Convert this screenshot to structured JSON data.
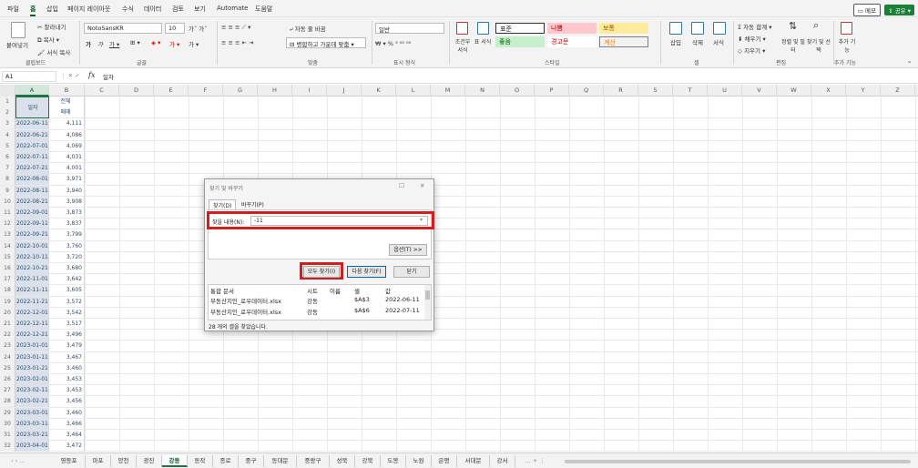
{
  "menu": {
    "file": "파일",
    "home": "홈",
    "insert": "삽입",
    "layout": "페이지 레이아웃",
    "formula": "수식",
    "data": "데이터",
    "review": "검토",
    "view": "보기",
    "automate": "Automate",
    "help": "도움말",
    "memo": "메모",
    "share": "공유"
  },
  "ribbon": {
    "clipboard": {
      "paste": "붙여넣기",
      "cut": "잘라내기",
      "copy": "복사",
      "format_painter": "서식 복사",
      "group": "클립보드"
    },
    "font": {
      "name": "NotoSansKR",
      "size": "10",
      "group": "글꼴"
    },
    "align": {
      "wrap": "자동 줄 바꿈",
      "merge": "병합하고 가운데 맞춤",
      "group": "맞춤"
    },
    "number": {
      "format": "일반",
      "group": "표시 형식"
    },
    "styles": {
      "cond": "조건부 서식",
      "table": "표 서식",
      "normal": "표준",
      "bad": "나쁨",
      "neutral": "보통",
      "good": "좋음",
      "warning": "경고문",
      "calc": "계산",
      "group": "스타일"
    },
    "cells": {
      "insert": "삽입",
      "delete": "삭제",
      "format": "서식",
      "group": "셀"
    },
    "edit": {
      "autosum": "자동 합계",
      "fill": "채우기",
      "clear": "지우기",
      "sort": "정렬 및 필터",
      "find": "찾기 및 선택",
      "group": "편집"
    },
    "addin": {
      "label": "추가 기능",
      "group": "추가 기능"
    }
  },
  "namebox": "A1",
  "formula": "일자",
  "columns": [
    "A",
    "B",
    "C",
    "D",
    "E",
    "F",
    "G",
    "H",
    "I",
    "J",
    "K",
    "L",
    "M",
    "N",
    "O",
    "P",
    "Q",
    "R",
    "S",
    "T",
    "U",
    "V",
    "W",
    "X",
    "Y",
    "Z"
  ],
  "header": {
    "a": "일자",
    "b1": "전체",
    "b2": "매매"
  },
  "rows": [
    [
      "3",
      "2022-06-11",
      "4,111"
    ],
    [
      "4",
      "2022-06-21",
      "4,086"
    ],
    [
      "5",
      "2022-07-01",
      "4,069"
    ],
    [
      "6",
      "2022-07-11",
      "4,031"
    ],
    [
      "7",
      "2022-07-21",
      "4,001"
    ],
    [
      "8",
      "2022-08-01",
      "3,971"
    ],
    [
      "9",
      "2022-08-11",
      "3,940"
    ],
    [
      "10",
      "2022-08-21",
      "3,908"
    ],
    [
      "11",
      "2022-09-01",
      "3,873"
    ],
    [
      "12",
      "2022-09-11",
      "3,837"
    ],
    [
      "13",
      "2022-09-21",
      "3,799"
    ],
    [
      "14",
      "2022-10-01",
      "3,760"
    ],
    [
      "15",
      "2022-10-11",
      "3,720"
    ],
    [
      "16",
      "2022-10-21",
      "3,680"
    ],
    [
      "17",
      "2022-11-01",
      "3,642"
    ],
    [
      "18",
      "2022-11-11",
      "3,605"
    ],
    [
      "19",
      "2022-11-21",
      "3,572"
    ],
    [
      "20",
      "2022-12-01",
      "3,542"
    ],
    [
      "21",
      "2022-12-11",
      "3,517"
    ],
    [
      "22",
      "2022-12-21",
      "3,496"
    ],
    [
      "23",
      "2023-01-01",
      "3,479"
    ],
    [
      "24",
      "2023-01-11",
      "3,467"
    ],
    [
      "25",
      "2023-01-21",
      "3,460"
    ],
    [
      "26",
      "2023-02-01",
      "3,453"
    ],
    [
      "27",
      "2023-02-11",
      "3,453"
    ],
    [
      "28",
      "2023-02-21",
      "3,456"
    ],
    [
      "29",
      "2023-03-01",
      "3,460"
    ],
    [
      "30",
      "2023-03-11",
      "3,466"
    ],
    [
      "31",
      "2023-03-21",
      "3,464"
    ],
    [
      "32",
      "2023-04-01",
      "3,472"
    ]
  ],
  "tabs": [
    "영등포",
    "마포",
    "양천",
    "광진",
    "강동",
    "동작",
    "종로",
    "중구",
    "동대문",
    "중랑구",
    "성북",
    "강북",
    "도봉",
    "노원",
    "은평",
    "서대문",
    "강서"
  ],
  "active_tab": "강동",
  "dialog": {
    "title": "찾기 및 바꾸기",
    "tab_find": "찾기(D)",
    "tab_replace": "바꾸기(P)",
    "find_label": "찾을 내용(N):",
    "find_value": "-11",
    "options": "옵션(T) >>",
    "find_all": "모두 찾기(I)",
    "find_next": "다음 찾기(F)",
    "close": "닫기",
    "col_book": "통합 문서",
    "col_sheet": "시트",
    "col_name": "이름",
    "col_cell": "셀",
    "col_value": "값",
    "results": [
      {
        "book": "부동산지인_로우데이터.xlsx",
        "sheet": "강동",
        "cell": "$A$3",
        "value": "2022-06-11"
      },
      {
        "book": "부동산지인_로우데이터.xlsx",
        "sheet": "강동",
        "cell": "$A$6",
        "value": "2022-07-11"
      }
    ],
    "status": "28 개의 셀을 찾았습니다."
  },
  "colors": {
    "accent": "#217346",
    "highlight": "#d21e1e",
    "selection": "#dbe1ea"
  }
}
